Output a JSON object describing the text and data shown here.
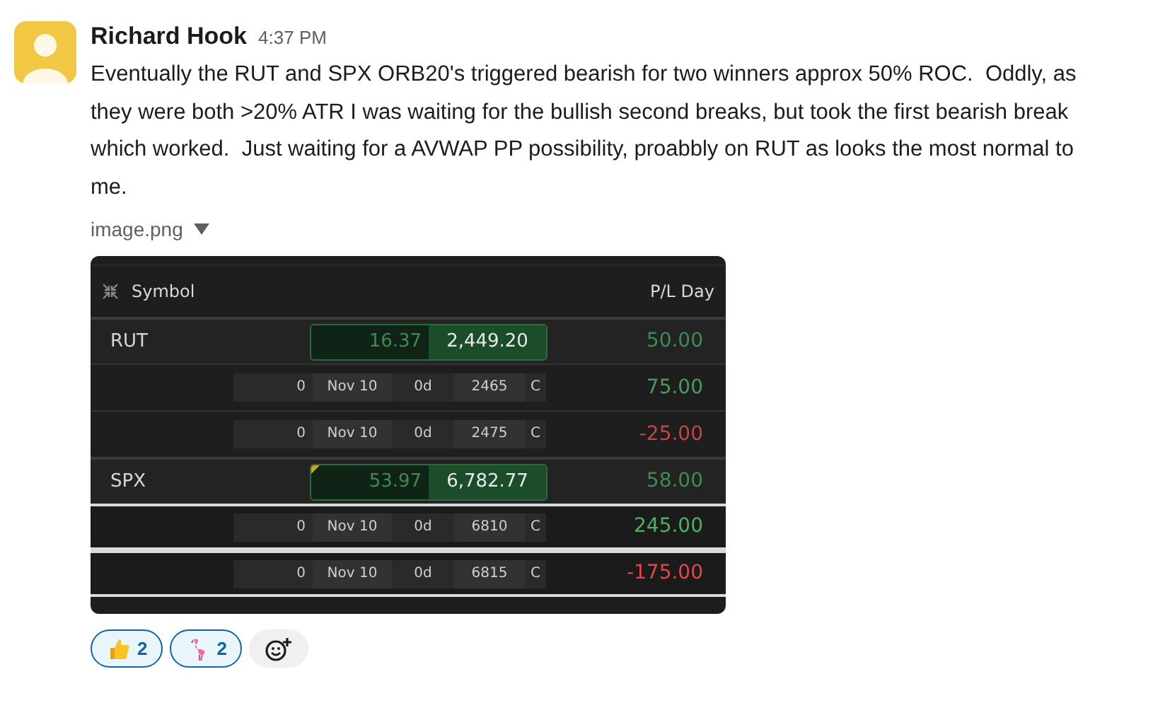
{
  "message": {
    "author": "Richard Hook",
    "time": "4:37 PM",
    "text": "Eventually the RUT and SPX ORB20's triggered bearish for two winners approx 50% ROC.  Oddly, as they were both >20% ATR I was waiting for the bullish second breaks, but took the first bearish break which worked.  Just waiting for a AVWAP PP possibility, proabbly on RUT as looks the most normal to me."
  },
  "attachment": {
    "filename": "image.png",
    "expanded": true,
    "table": {
      "columns": [
        "Symbol",
        "P/L Day"
      ],
      "rows": [
        {
          "kind": "underlying",
          "symbol": "RUT",
          "mark": "16.37",
          "last": "2,449.20",
          "flagged": false,
          "pl": "50.00",
          "color": "#3f8a52",
          "selected": false
        },
        {
          "kind": "option",
          "qty": "0",
          "expiry": "Nov 10",
          "dte": "0d",
          "strike": "2465",
          "type": "C",
          "pl": "75.00",
          "color": "#4a9a5c",
          "selected": false
        },
        {
          "kind": "option",
          "qty": "0",
          "expiry": "Nov 10",
          "dte": "0d",
          "strike": "2475",
          "type": "C",
          "pl": "-25.00",
          "color": "#c24446",
          "selected": false
        },
        {
          "kind": "underlying",
          "symbol": "SPX",
          "mark": "53.97",
          "last": "6,782.77",
          "flagged": true,
          "pl": "58.00",
          "color": "#3f8a52",
          "selected": false
        },
        {
          "kind": "option",
          "qty": "0",
          "expiry": "Nov 10",
          "dte": "0d",
          "strike": "6810",
          "type": "C",
          "pl": "245.00",
          "color": "#4caf62",
          "selected": true
        },
        {
          "kind": "option",
          "qty": "0",
          "expiry": "Nov 10",
          "dte": "0d",
          "strike": "6815",
          "type": "C",
          "pl": "-175.00",
          "color": "#e0464a",
          "selected": true
        }
      ]
    }
  },
  "reactions": [
    {
      "kind": "thumbs-up",
      "count": "2",
      "selected": true
    },
    {
      "kind": "flamingo",
      "count": "2",
      "selected": true
    }
  ]
}
